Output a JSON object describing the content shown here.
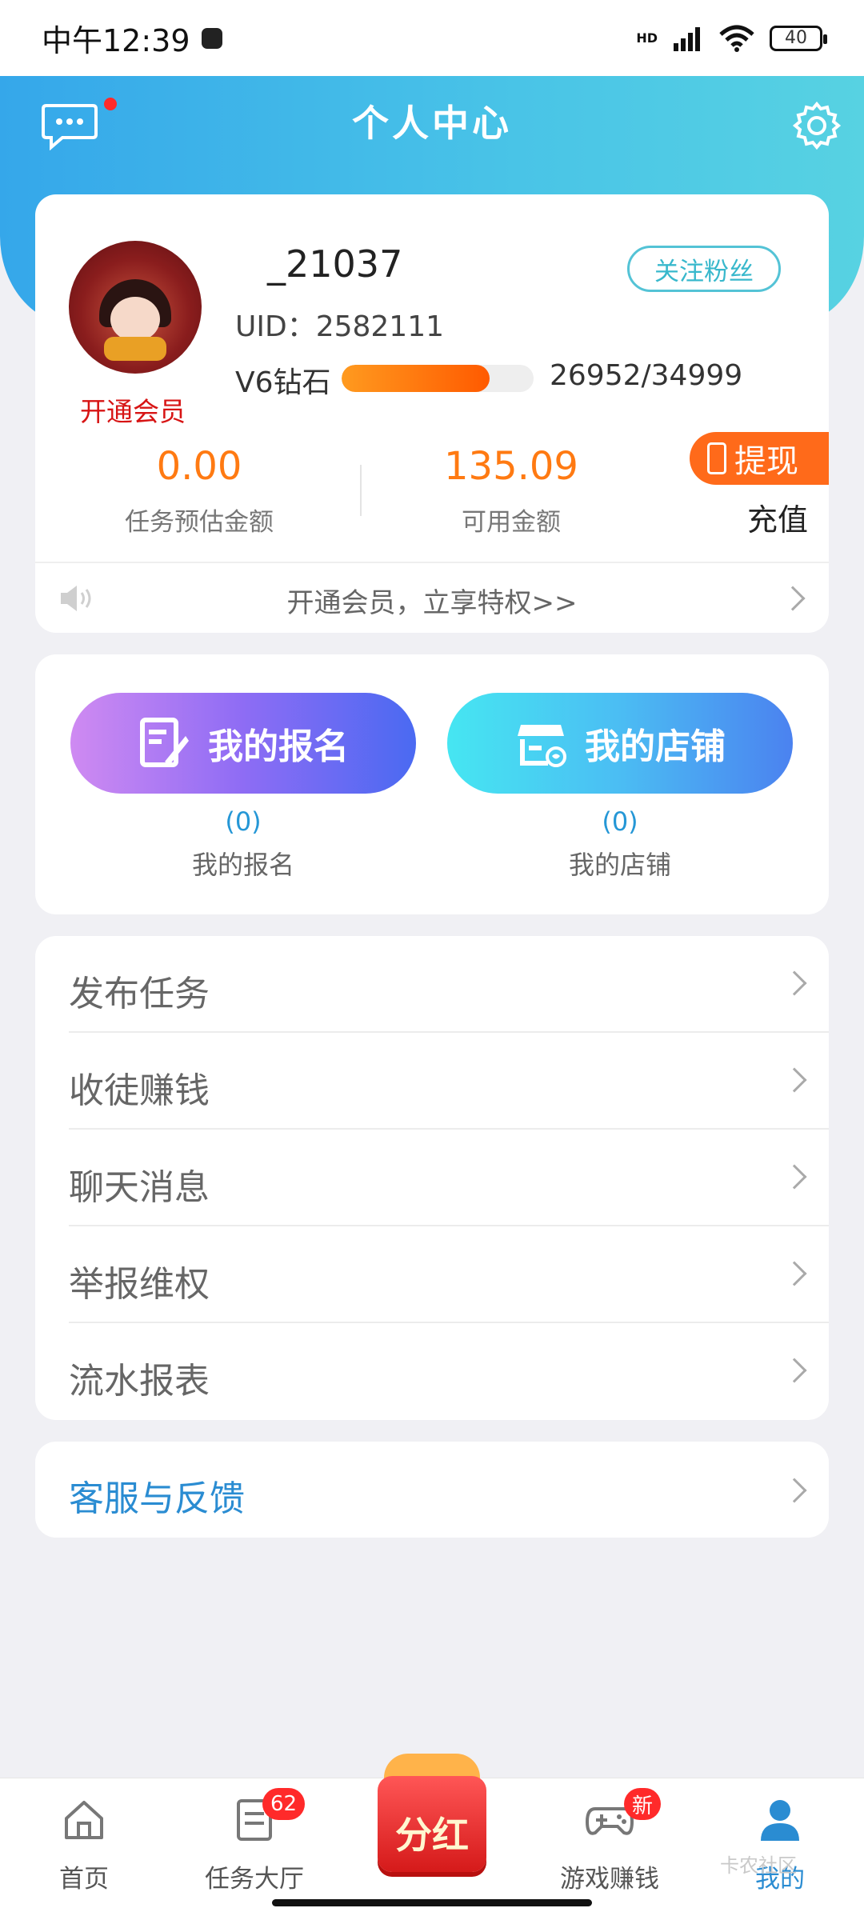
{
  "status_bar": {
    "time": "中午12:39",
    "network": "HD",
    "battery": "40"
  },
  "header": {
    "title": "个人中心"
  },
  "profile": {
    "vip_link": "开通会员",
    "username": "_21037",
    "uid": "UID：2582111",
    "follow_button": "关注粉丝",
    "level_label": "V6钻石",
    "level_progress_text": "26952/34999",
    "level_progress_fraction": 0.77,
    "withdraw_button": "提现",
    "recharge_button": "充值",
    "amount_estimated": "0.00",
    "amount_estimated_label": "任务预估金额",
    "amount_available": "135.09",
    "amount_available_label": "可用金额",
    "notice": "开通会员，立享特权>>"
  },
  "quick_actions": [
    {
      "button": "我的报名",
      "count": "(0)",
      "label": "我的报名"
    },
    {
      "button": "我的店铺",
      "count": "(0)",
      "label": "我的店铺"
    }
  ],
  "menu": [
    {
      "label": "发布任务"
    },
    {
      "label": "收徒赚钱"
    },
    {
      "label": "聊天消息"
    },
    {
      "label": "举报维权"
    },
    {
      "label": "流水报表"
    }
  ],
  "service": {
    "label": "客服与反馈"
  },
  "bottom_nav": {
    "home": "首页",
    "tasks": "任务大厅",
    "tasks_badge": "62",
    "dividend": "分红",
    "games": "游戏赚钱",
    "games_badge": "新",
    "mine": "我的"
  },
  "watermark": "卡农社区",
  "colors": {
    "accent_blue": "#35a7ea",
    "orange": "#ff7a12",
    "link_blue": "#2a8cd2",
    "vip_red": "#d71414"
  }
}
